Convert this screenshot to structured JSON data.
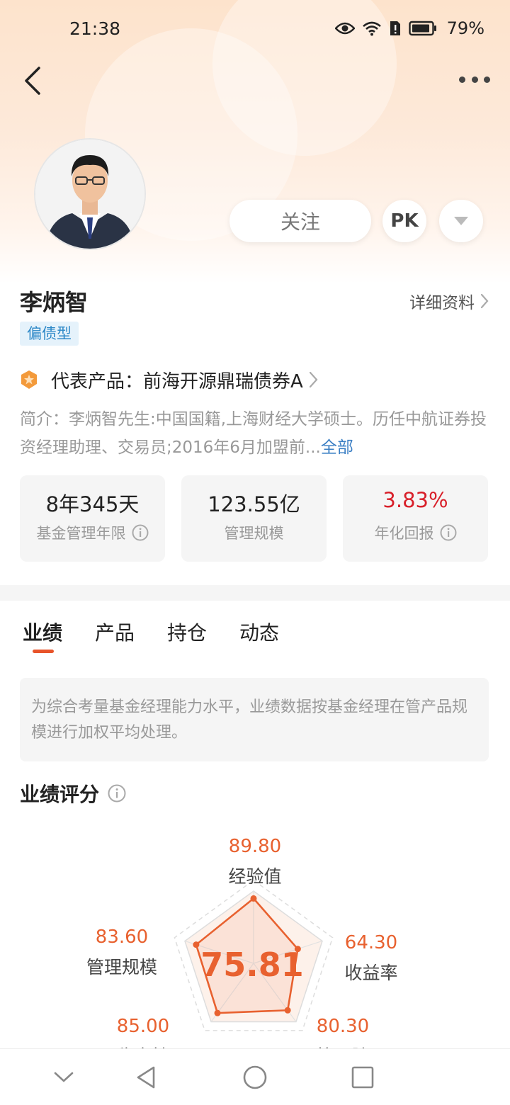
{
  "status": {
    "time": "21:38",
    "battery": "79%"
  },
  "header": {
    "back_icon": "chevron-left-icon",
    "more_icon": "more-dots-icon"
  },
  "profile": {
    "name": "李炳智",
    "detail_link": "详细资料",
    "tag": "偏债型",
    "follow_label": "关注",
    "pk_label": "PK"
  },
  "representative": {
    "label": "代表产品：",
    "product": "前海开源鼎瑞债券A"
  },
  "intro": {
    "text": "简介：李炳智先生:中国国籍,上海财经大学硕士。历任中航证券投资经理助理、交易员;2016年6月加盟前...",
    "all_label": "全部"
  },
  "stats": [
    {
      "value": "8年345天",
      "label": "基金管理年限"
    },
    {
      "value": "123.55亿",
      "label": "管理规模"
    },
    {
      "value": "3.83%",
      "label": "年化回报",
      "color": "#d8202a"
    }
  ],
  "tabs": [
    "业绩",
    "产品",
    "持仓",
    "动态"
  ],
  "note": "为综合考量基金经理能力水平，业绩数据按基金经理在管产品规模进行加权平均处理。",
  "score": {
    "title": "业绩评分",
    "total": "75.81",
    "accent": "#e8612f",
    "dims": [
      {
        "label": "经验值",
        "value": "89.80"
      },
      {
        "label": "收益率",
        "value": "64.30"
      },
      {
        "label": "抗风险",
        "value": "80.30"
      },
      {
        "label": "稳定性",
        "value": "85.00"
      },
      {
        "label": "管理规模",
        "value": "83.60"
      }
    ]
  }
}
